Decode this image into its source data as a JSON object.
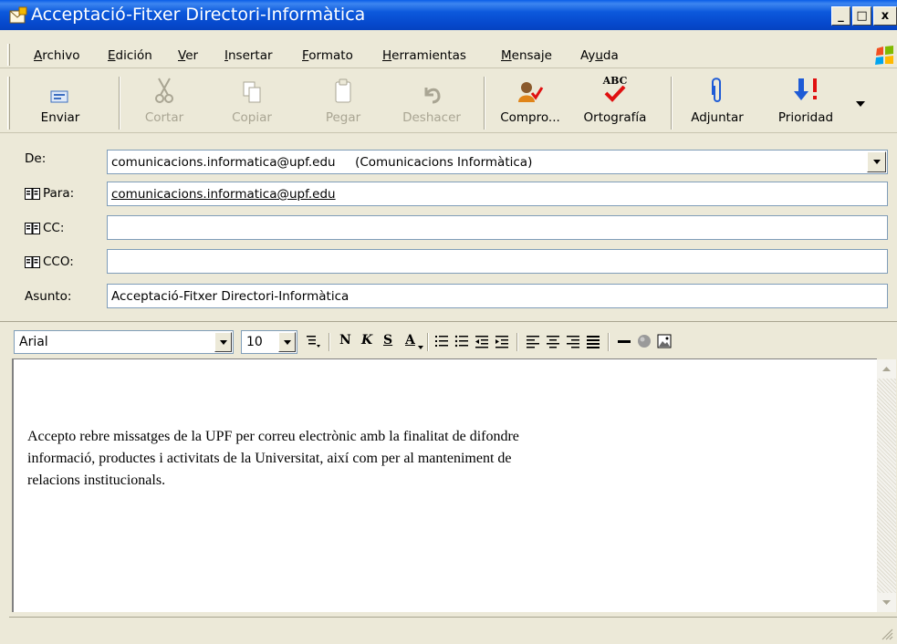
{
  "window": {
    "title": "Acceptació-Fitxer Directori-Informàtica",
    "controls": [
      "_",
      "□",
      "x"
    ]
  },
  "menu": [
    {
      "pre": "",
      "u": "A",
      "post": "rchivo"
    },
    {
      "pre": "",
      "u": "E",
      "post": "dición"
    },
    {
      "pre": "",
      "u": "V",
      "post": "er"
    },
    {
      "pre": "",
      "u": "I",
      "post": "nsertar"
    },
    {
      "pre": "",
      "u": "F",
      "post": "ormato"
    },
    {
      "pre": "",
      "u": "H",
      "post": "erramientas"
    },
    {
      "pre": "",
      "u": "M",
      "post": "ensaje"
    },
    {
      "pre": "Ay",
      "u": "u",
      "post": "da"
    }
  ],
  "toolbar": {
    "send": "Enviar",
    "cut": "Cortar",
    "copy": "Copiar",
    "paste": "Pegar",
    "undo": "Deshacer",
    "check": "Compro...",
    "spelling": "Ortografía",
    "spelling_icon_text": "ABC",
    "attach": "Adjuntar",
    "priority": "Prioridad"
  },
  "header": {
    "from_label": "De:",
    "from_value": "comunicacions.informatica@upf.edu     (Comunicacions Informàtica)",
    "to_label": "Para:",
    "to_value": "comunicacions.informatica@upf.edu",
    "cc_label": "CC:",
    "cc_value": "",
    "bcc_label": "CCO:",
    "bcc_value": "",
    "subject_label": "Asunto:",
    "subject_value": "Acceptació-Fitxer Directori-Informàtica"
  },
  "format": {
    "font": "Arial",
    "size": "10",
    "bold": "N",
    "italic": "K",
    "underline": "S",
    "color": "A"
  },
  "body": {
    "line1": "Accepto rebre missatges de la UPF per correu electrònic amb la finalitat de difondre",
    "line2": "informació, productes i activitats de la Universitat, així com per al manteniment de",
    "line3": "relacions institucionals."
  },
  "colors": {
    "titlebar": "#0a5ee8",
    "chrome": "#ece9d8",
    "field_border": "#7f9db9"
  }
}
